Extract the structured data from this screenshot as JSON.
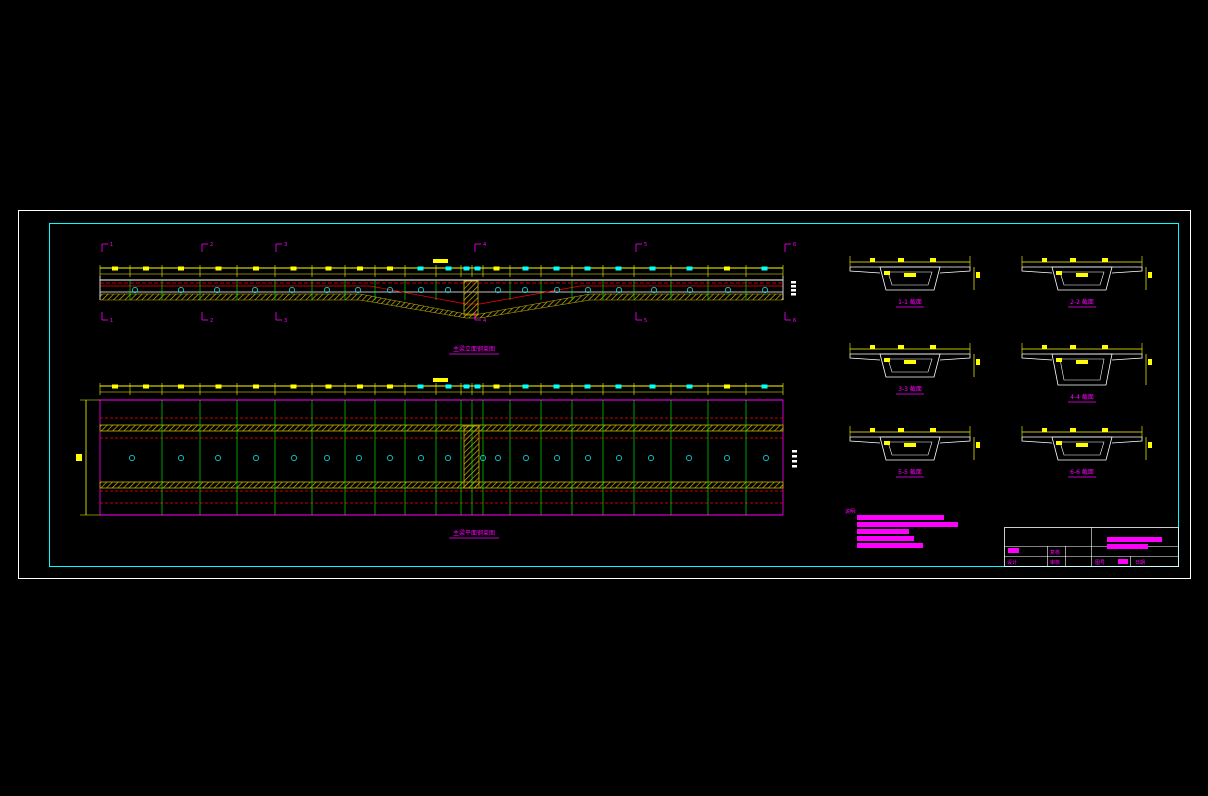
{
  "drawing": {
    "elevation_title": "主梁立面钢束图",
    "plan_title": "主梁平面钢束图",
    "section_marks": [
      "1",
      "2",
      "3",
      "4",
      "5",
      "6"
    ],
    "sections": [
      {
        "label": "1-1 截面",
        "type": "single"
      },
      {
        "label": "2-2 截面",
        "type": "single"
      },
      {
        "label": "3-3 截面",
        "type": "single"
      },
      {
        "label": "4-4 截面",
        "type": "double"
      },
      {
        "label": "5-5 截面",
        "type": "single"
      },
      {
        "label": "6-6 截面",
        "type": "single"
      }
    ],
    "notes_heading": "说明:"
  },
  "title_block": {
    "design": "设计",
    "check": "复核",
    "review": "审核",
    "date": "日期",
    "drawing_no": "图号"
  },
  "colors": {
    "background": "#000000",
    "outer_frame": "#ffffff",
    "inner_frame": "#00ffff",
    "dimension": "#ffff00",
    "annotation": "#ff00ff",
    "beam_outline": "#ffffff",
    "hatch": "#c8b400",
    "tendon": "#ff0000",
    "stirrup": "#00ff00",
    "duct": "#00ffff"
  }
}
